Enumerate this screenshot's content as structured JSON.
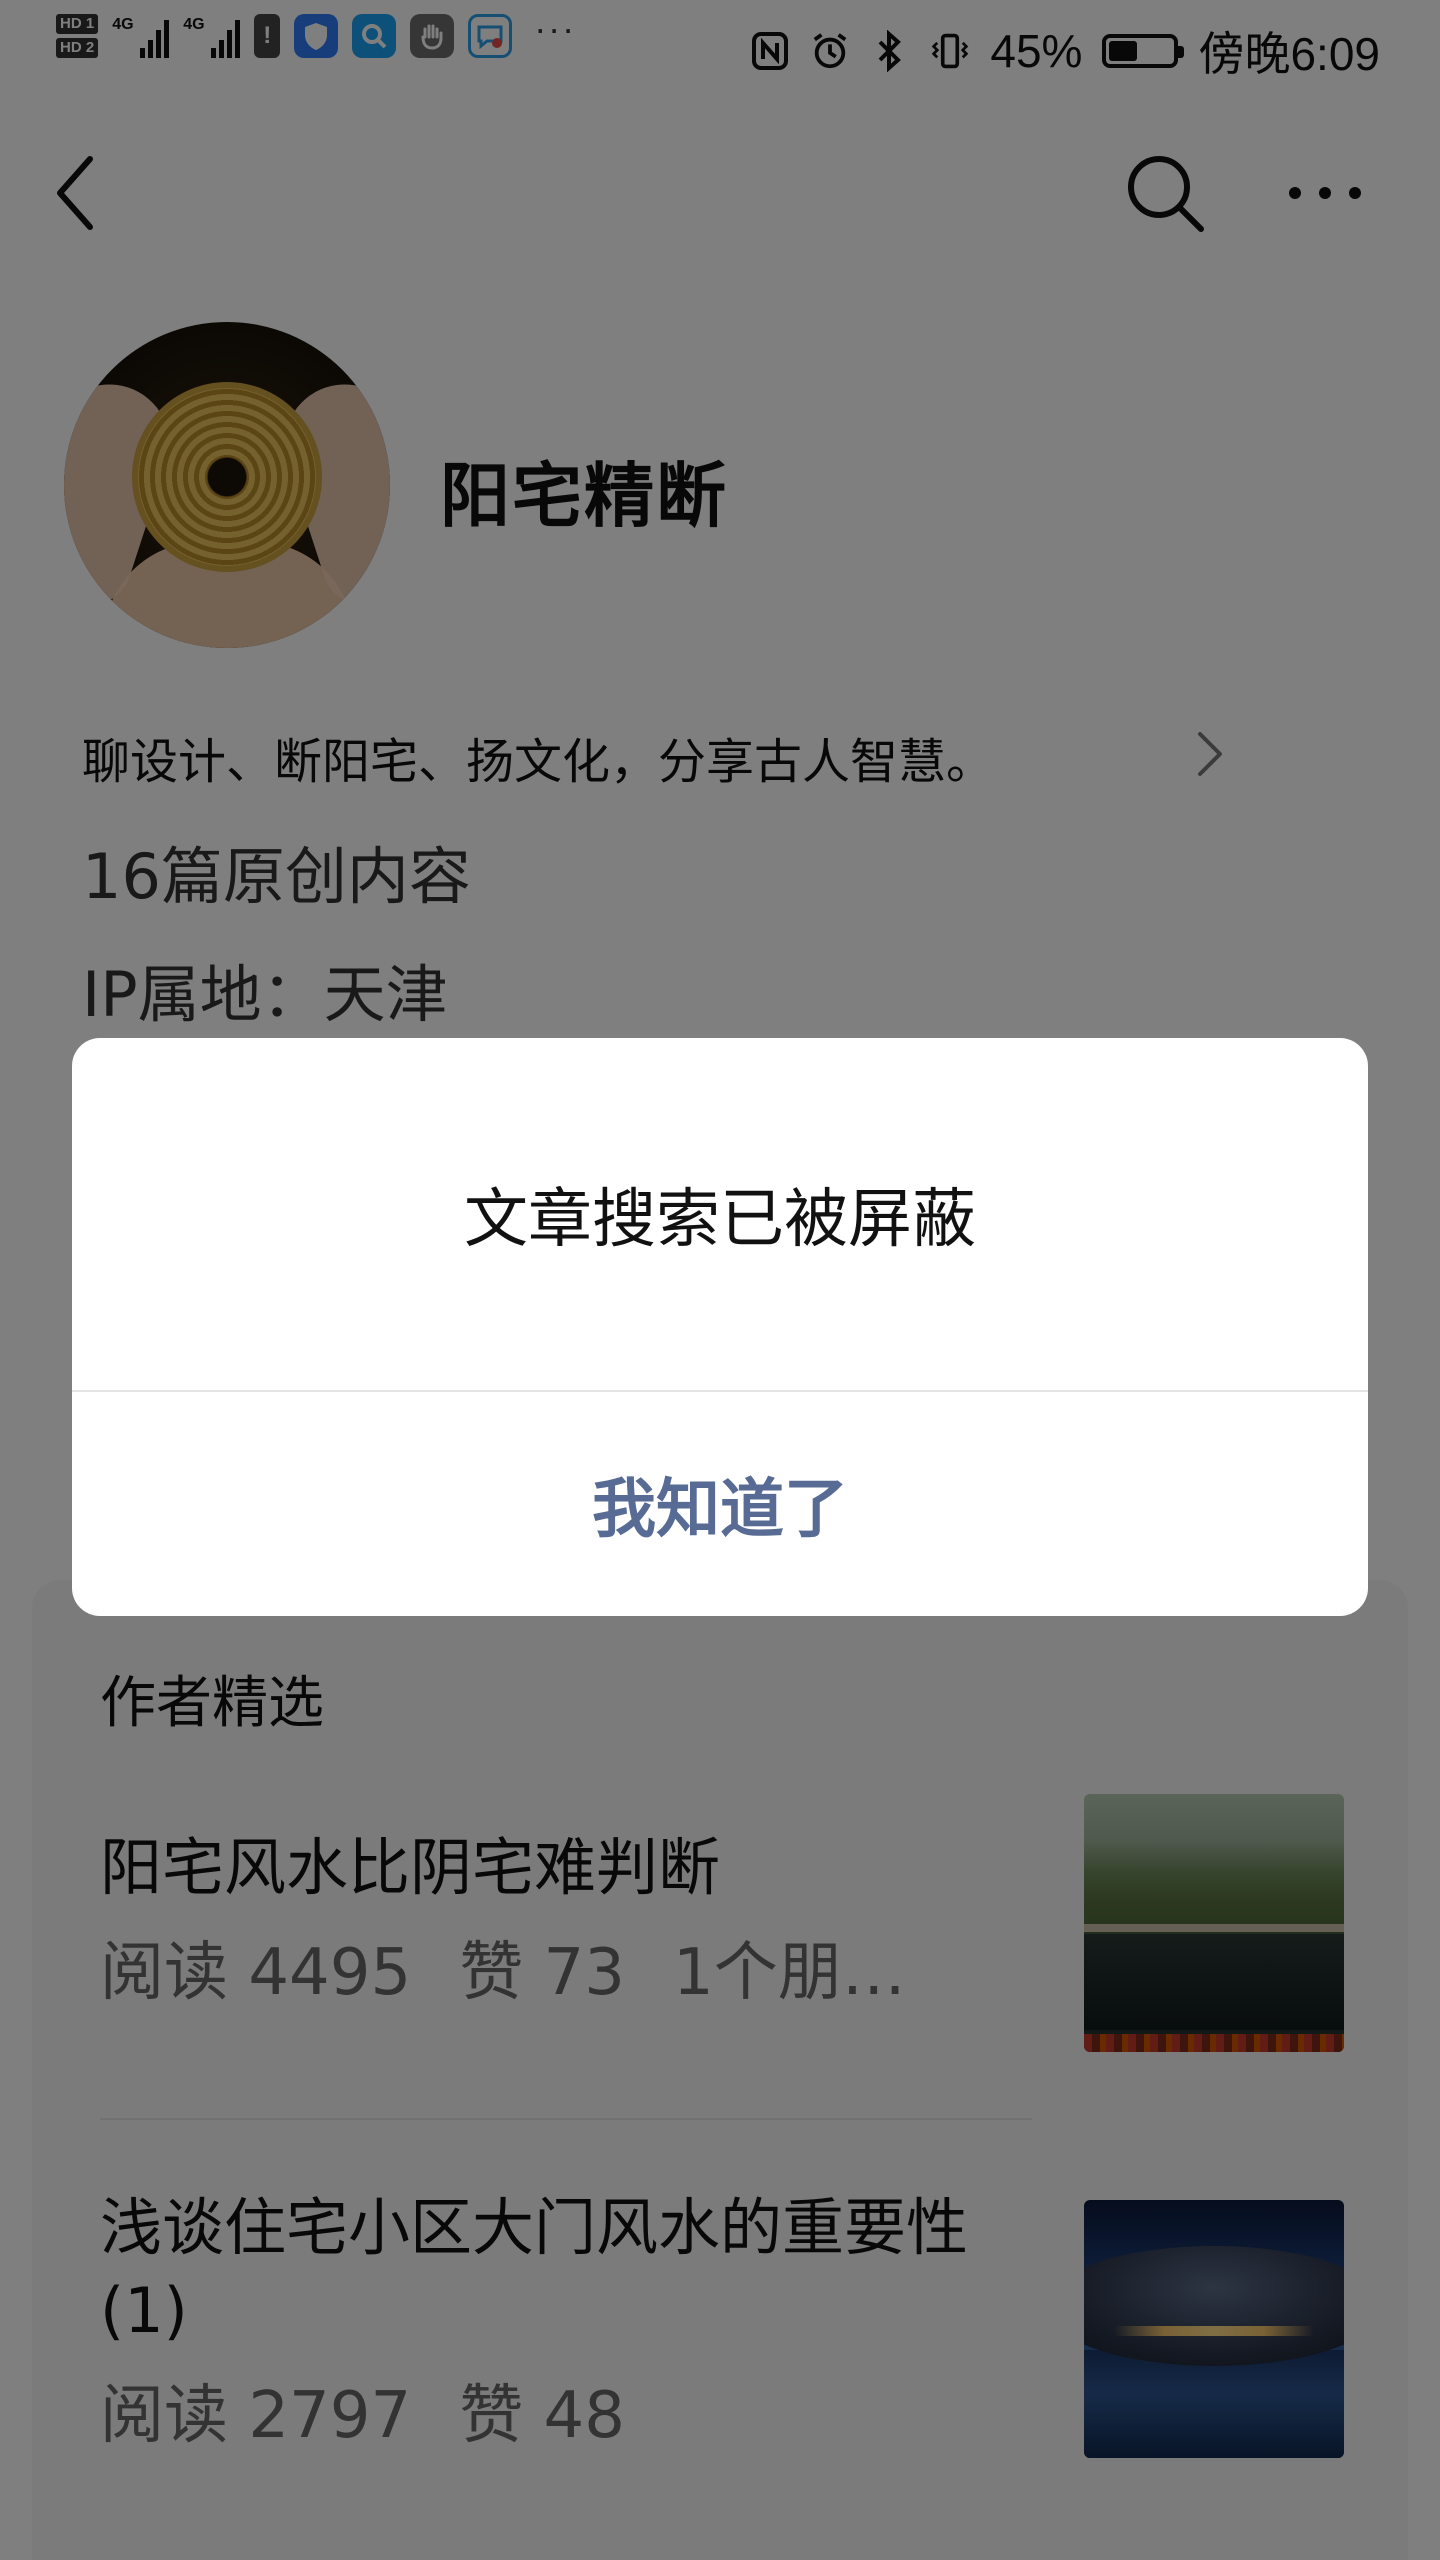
{
  "status_bar": {
    "hd1": "HD 1",
    "hd2": "HD 2",
    "network1": "4G",
    "network2": "4G",
    "battery_percent": "45%",
    "battery_level": 0.45,
    "time": "傍晚6:09",
    "more": "···",
    "icons": [
      "signal-icon",
      "warning-icon",
      "shield-app-icon",
      "search-app-icon",
      "hand-app-icon",
      "chat-app-icon",
      "nfc-icon",
      "alarm-icon",
      "bluetooth-icon",
      "vibrate-icon",
      "battery-icon"
    ]
  },
  "nav": {
    "back_icon": "chevron-left-icon",
    "search_icon": "search-icon",
    "more_icon": "more-dots-icon"
  },
  "profile": {
    "name": "阳宅精断",
    "description": "聊设计、断阳宅、扬文化，分享古人智慧。",
    "original_count": "16篇原创内容",
    "ip_location": "IP属地：天津"
  },
  "picks": {
    "title": "作者精选",
    "articles": [
      {
        "title": "阳宅风水比阴宅难判断",
        "meta": [
          "阅读 4495",
          "赞 73",
          "1个朋…"
        ]
      },
      {
        "title": "浅谈住宅小区大门风水的重要性(1)",
        "meta": [
          "阅读 2797",
          "赞 48"
        ]
      }
    ]
  },
  "dialog": {
    "message": "文章搜索已被屏蔽",
    "button_label": "我知道了"
  },
  "colors": {
    "overlay": "#000000",
    "dialog_button": "#576b95",
    "card_background": "#f7f7f7"
  }
}
